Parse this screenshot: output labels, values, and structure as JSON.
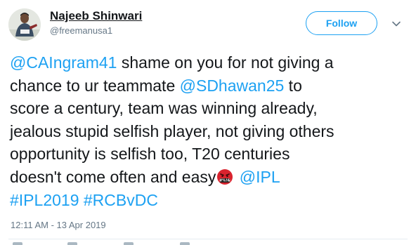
{
  "user": {
    "name": "Najeeb Shinwari",
    "handle": "@freemanusa1",
    "avatar_icon": "profile-photo"
  },
  "follow_button": {
    "label": "Follow"
  },
  "menu_icon": "chevron-down-icon",
  "tweet": {
    "lines": [
      [
        {
          "type": "mention",
          "text": "@CAIngram41"
        },
        {
          "type": "text",
          "text": " shame on you for not giving a"
        }
      ],
      [
        {
          "type": "text",
          "text": "chance to ur teammate "
        },
        {
          "type": "mention",
          "text": "@SDhawan25"
        },
        {
          "type": "text",
          "text": " to"
        }
      ],
      [
        {
          "type": "text",
          "text": "score a century, team was winning already,"
        }
      ],
      [
        {
          "type": "text",
          "text": "jealous stupid selfish player, not giving others"
        }
      ],
      [
        {
          "type": "text",
          "text": "opportunity is selfish too, T20 centuries"
        }
      ],
      [
        {
          "type": "text",
          "text": "doesn't come often and easy"
        },
        {
          "type": "emoji",
          "icon": "angry-cursing-face-emoji"
        },
        {
          "type": "text",
          "text": " "
        },
        {
          "type": "mention",
          "text": "@IPL"
        }
      ],
      [
        {
          "type": "hashtag",
          "text": "#IPL2019"
        },
        {
          "type": "text",
          "text": " "
        },
        {
          "type": "hashtag",
          "text": "#RCBvDC"
        }
      ]
    ]
  },
  "timestamp": "12:11 AM - 13 Apr 2019",
  "colors": {
    "link": "#1da1f2",
    "text": "#14171a",
    "secondary": "#657786",
    "emoji_red": "#d9232e"
  }
}
